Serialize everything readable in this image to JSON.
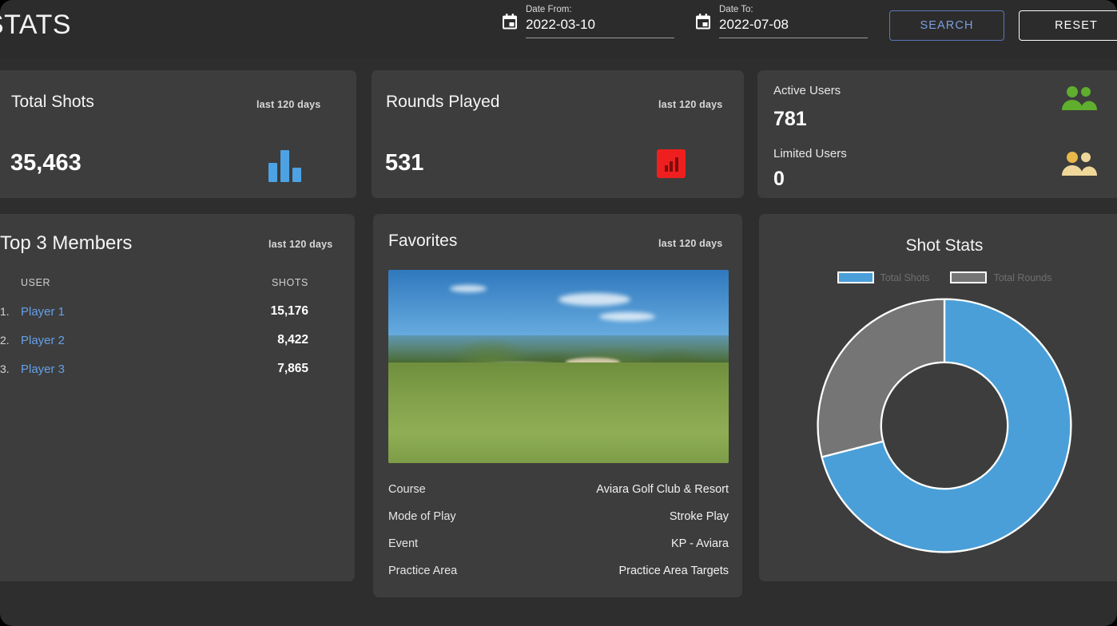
{
  "header": {
    "title": "STATS",
    "date_from": {
      "label": "Date From:",
      "value": "2022-03-10",
      "icon": "calendar-icon"
    },
    "date_to": {
      "label": "Date To:",
      "value": "2022-07-08",
      "icon": "calendar-icon"
    },
    "search_label": "SEARCH",
    "reset_label": "RESET",
    "search_color": "#7c9ee0",
    "reset_color": "#ffffff"
  },
  "total_shots": {
    "title": "Total Shots",
    "period": "last 120 days",
    "value": "35,463",
    "icon": "bar-chart-icon",
    "icon_color": "#4da2e3"
  },
  "rounds_played": {
    "title": "Rounds Played",
    "period": "last 120 days",
    "value": "531",
    "icon": "red-chart-icon",
    "icon_color": "#f01f1f"
  },
  "users": {
    "active_label": "Active Users",
    "active_value": "781",
    "active_icon": "people-icon",
    "active_color": "#5fae2e",
    "limited_label": "Limited Users",
    "limited_value": "0",
    "limited_icon": "people-icon",
    "limited_color": "#e8b94a"
  },
  "top_members": {
    "title": "Top 3 Members",
    "period": "last 120 days",
    "columns": {
      "user": "USER",
      "shots": "SHOTS"
    },
    "rows": [
      {
        "rank": "1.",
        "user": "Player 1",
        "shots": "15,176"
      },
      {
        "rank": "2.",
        "user": "Player 2",
        "shots": "8,422"
      },
      {
        "rank": "3.",
        "user": "Player 3",
        "shots": "7,865"
      }
    ]
  },
  "favorites": {
    "title": "Favorites",
    "period": "last 120 days",
    "photo_alt": "golf-practice-area-photo",
    "rows": [
      {
        "key": "Course",
        "value": "Aviara Golf Club & Resort"
      },
      {
        "key": "Mode of Play",
        "value": "Stroke Play"
      },
      {
        "key": "Event",
        "value": "KP - Aviara"
      },
      {
        "key": "Practice Area",
        "value": "Practice Area Targets"
      }
    ]
  },
  "shot_stats": {
    "title": "Shot Stats"
  },
  "chart_data": {
    "type": "pie",
    "title": "Shot Stats",
    "variant": "donut",
    "legend_position": "top",
    "labels": [
      "Total Shots",
      "Total Rounds"
    ],
    "values": [
      71,
      29
    ],
    "colors": [
      "#4a9fd8",
      "#757575"
    ],
    "slice_border_color": "#ffffff",
    "start_angle_deg": 0,
    "inner_radius_ratio": 0.5
  }
}
